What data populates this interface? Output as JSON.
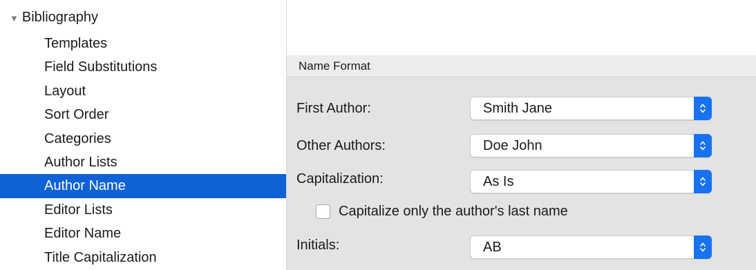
{
  "sidebar": {
    "root_label": "Bibliography",
    "items": [
      {
        "label": "Templates"
      },
      {
        "label": "Field Substitutions"
      },
      {
        "label": "Layout"
      },
      {
        "label": "Sort Order"
      },
      {
        "label": "Categories"
      },
      {
        "label": "Author Lists"
      },
      {
        "label": "Author Name",
        "selected": true
      },
      {
        "label": "Editor Lists"
      },
      {
        "label": "Editor Name"
      },
      {
        "label": "Title Capitalization"
      }
    ]
  },
  "name_format": {
    "header": "Name Format",
    "first_author": {
      "label": "First Author:",
      "value": "Smith Jane"
    },
    "other_authors": {
      "label": "Other Authors:",
      "value": "Doe John"
    },
    "capitalization": {
      "label": "Capitalization:",
      "value": "As Is"
    },
    "capitalize_last_name": {
      "label": "Capitalize only the author's last name",
      "checked": false
    },
    "initials": {
      "label": "Initials:",
      "value": "AB"
    }
  },
  "colors": {
    "selection": "#0f61d6",
    "popup_accent": "#1872ef",
    "panel_background": "#e3e3e3"
  },
  "icons": [
    "disclosure-triangle-down-icon",
    "chevron-up-down-icon"
  ]
}
